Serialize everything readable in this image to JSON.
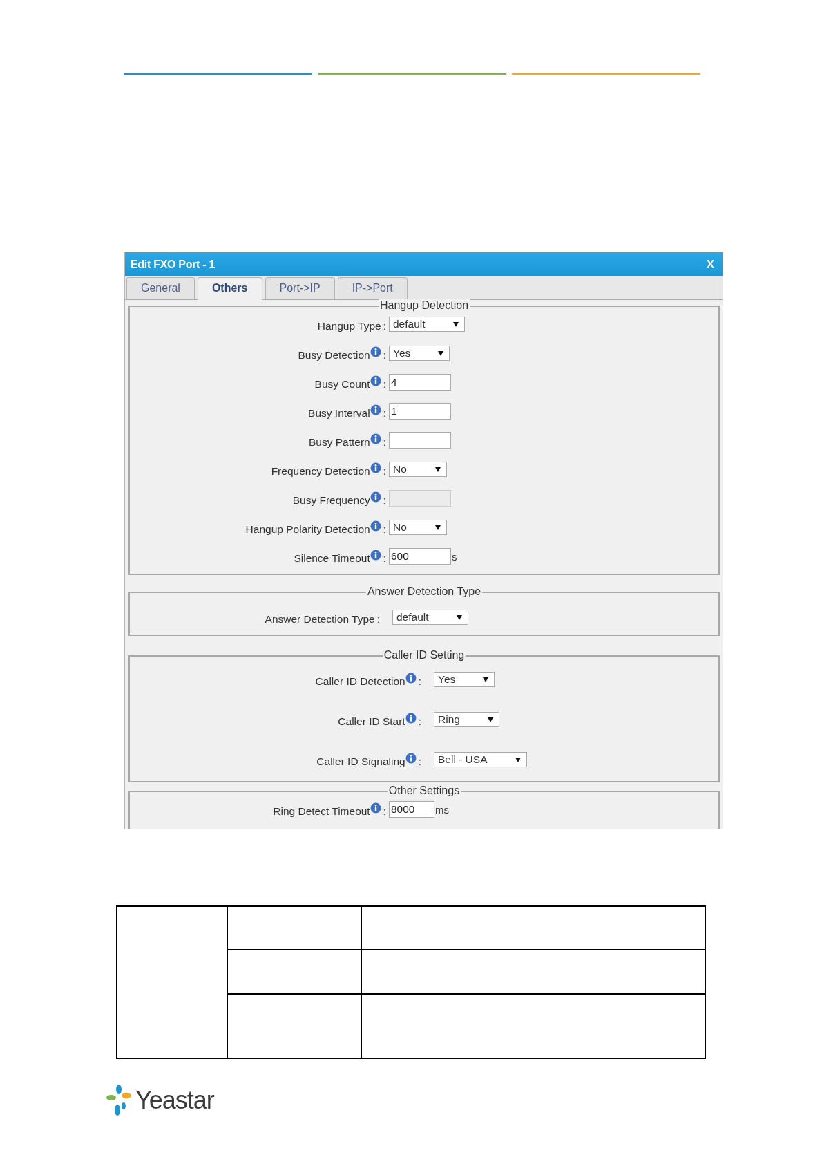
{
  "header_rules": [
    {
      "color": "#1a96d4"
    },
    {
      "color": "#7ab648"
    },
    {
      "color": "#f5a623"
    }
  ],
  "dialog": {
    "title": "Edit FXO Port - 1",
    "close": "X",
    "tabs": [
      {
        "label": "General",
        "selected": false
      },
      {
        "label": "Others",
        "selected": true
      },
      {
        "label": "Port->IP",
        "selected": false
      },
      {
        "label": "IP->Port",
        "selected": false
      }
    ],
    "sections": [
      {
        "legend": "Hangup Detection",
        "fields": [
          {
            "label": "Hangup Type",
            "info": false,
            "sep": ":",
            "kind": "select",
            "value": "default"
          },
          {
            "label": "Busy Detection",
            "info": true,
            "sep": ":",
            "kind": "select",
            "value": "Yes"
          },
          {
            "label": "Busy Count",
            "info": true,
            "sep": ":",
            "kind": "text",
            "value": "4"
          },
          {
            "label": "Busy Interval",
            "info": true,
            "sep": ":",
            "kind": "text",
            "value": "1"
          },
          {
            "label": "Busy Pattern",
            "info": true,
            "sep": ":",
            "kind": "text"
          },
          {
            "label": "Frequency Detection",
            "info": true,
            "sep": ":",
            "kind": "select",
            "value": "No"
          },
          {
            "label": "Busy Frequency",
            "info": true,
            "sep": ":",
            "kind": "text",
            "disabled": true
          },
          {
            "label": "Hangup Polarity Detection",
            "info": true,
            "sep": ":",
            "kind": "select",
            "value": "No"
          },
          {
            "label": "Silence Timeout",
            "info": true,
            "sep": ":",
            "kind": "text",
            "value": "600",
            "unit": "s"
          }
        ]
      },
      {
        "legend": "Answer Detection Type",
        "fields": [
          {
            "label": "Answer Detection Type",
            "info": false,
            "sep": ":",
            "kind": "select",
            "value": "default"
          }
        ]
      },
      {
        "legend": "Caller ID Setting",
        "fields": [
          {
            "label": "Caller ID Detection",
            "info": true,
            "sep": ":",
            "kind": "select",
            "value": "Yes"
          },
          {
            "label": "Caller ID Start",
            "info": true,
            "sep": ":",
            "kind": "select",
            "value": "Ring"
          },
          {
            "label": "Caller ID Signaling",
            "info": true,
            "sep": ":",
            "kind": "select",
            "value": "Bell - USA"
          }
        ]
      },
      {
        "legend": "Other Settings",
        "fields": [
          {
            "label": "Ring Detect Timeout",
            "info": true,
            "sep": ":",
            "kind": "text",
            "value": "8000",
            "unit": "ms"
          }
        ]
      }
    ]
  },
  "footer": {
    "brand": "Yeastar"
  }
}
